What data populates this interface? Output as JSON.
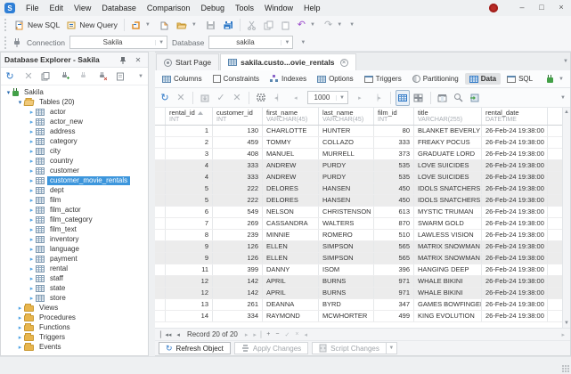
{
  "titlebar": {
    "menus": [
      "File",
      "Edit",
      "View",
      "Database",
      "Comparison",
      "Debug",
      "Tools",
      "Window",
      "Help"
    ]
  },
  "toolbar": {
    "new_sql_label": "New SQL",
    "new_query_label": "New Query"
  },
  "connection_bar": {
    "connection_label": "Connection",
    "connection_value": "Sakila",
    "database_label": "Database",
    "database_value": "sakila"
  },
  "sidebar": {
    "title": "Database Explorer - Sakila",
    "tree": [
      {
        "label": "Sakila",
        "depth": 0,
        "icon": "plug",
        "expand": "expanded"
      },
      {
        "label": "Tables (20)",
        "depth": 1,
        "icon": "folder-open",
        "expand": "expanded"
      },
      {
        "label": "actor",
        "depth": 2,
        "icon": "table",
        "expand": "collapsed"
      },
      {
        "label": "actor_new",
        "depth": 2,
        "icon": "table",
        "expand": "collapsed"
      },
      {
        "label": "address",
        "depth": 2,
        "icon": "table",
        "expand": "collapsed"
      },
      {
        "label": "category",
        "depth": 2,
        "icon": "table",
        "expand": "collapsed"
      },
      {
        "label": "city",
        "depth": 2,
        "icon": "table",
        "expand": "collapsed"
      },
      {
        "label": "country",
        "depth": 2,
        "icon": "table",
        "expand": "collapsed"
      },
      {
        "label": "customer",
        "depth": 2,
        "icon": "table",
        "expand": "collapsed"
      },
      {
        "label": "customer_movie_rentals",
        "depth": 2,
        "icon": "table",
        "expand": "collapsed",
        "selected": true
      },
      {
        "label": "dept",
        "depth": 2,
        "icon": "table",
        "expand": "collapsed"
      },
      {
        "label": "film",
        "depth": 2,
        "icon": "table",
        "expand": "collapsed"
      },
      {
        "label": "film_actor",
        "depth": 2,
        "icon": "table",
        "expand": "collapsed"
      },
      {
        "label": "film_category",
        "depth": 2,
        "icon": "table",
        "expand": "collapsed"
      },
      {
        "label": "film_text",
        "depth": 2,
        "icon": "table",
        "expand": "collapsed"
      },
      {
        "label": "inventory",
        "depth": 2,
        "icon": "table",
        "expand": "collapsed"
      },
      {
        "label": "language",
        "depth": 2,
        "icon": "table",
        "expand": "collapsed"
      },
      {
        "label": "payment",
        "depth": 2,
        "icon": "table",
        "expand": "collapsed"
      },
      {
        "label": "rental",
        "depth": 2,
        "icon": "table",
        "expand": "collapsed"
      },
      {
        "label": "staff",
        "depth": 2,
        "icon": "table",
        "expand": "collapsed"
      },
      {
        "label": "state",
        "depth": 2,
        "icon": "table",
        "expand": "collapsed"
      },
      {
        "label": "store",
        "depth": 2,
        "icon": "table",
        "expand": "collapsed"
      },
      {
        "label": "Views",
        "depth": 1,
        "icon": "folder",
        "expand": "collapsed"
      },
      {
        "label": "Procedures",
        "depth": 1,
        "icon": "folder",
        "expand": "collapsed"
      },
      {
        "label": "Functions",
        "depth": 1,
        "icon": "folder",
        "expand": "collapsed"
      },
      {
        "label": "Triggers",
        "depth": 1,
        "icon": "folder",
        "expand": "collapsed"
      },
      {
        "label": "Events",
        "depth": 1,
        "icon": "folder",
        "expand": "collapsed"
      }
    ]
  },
  "doc_tabs": {
    "start_page_label": "Start Page",
    "active_tab_label": "sakila.custo...ovie_rentals"
  },
  "subtabs": [
    {
      "label": "Columns",
      "icon": "columns-icon",
      "style": "grid"
    },
    {
      "label": "Constraints",
      "icon": "constraints-icon",
      "style": "brackets"
    },
    {
      "label": "Indexes",
      "icon": "indexes-icon",
      "style": "tree3"
    },
    {
      "label": "Options",
      "icon": "options-icon",
      "style": "grid"
    },
    {
      "label": "Triggers",
      "icon": "triggers-icon",
      "style": "window"
    },
    {
      "label": "Partitioning",
      "icon": "partitioning-icon",
      "style": "pie"
    },
    {
      "label": "Data",
      "icon": "data-icon",
      "style": "grid-blue",
      "active": true
    },
    {
      "label": "SQL",
      "icon": "sql-icon",
      "style": "window"
    }
  ],
  "data_toolbar": {
    "page_size": "1000"
  },
  "grid": {
    "columns": [
      {
        "name": "rental_id",
        "type": "INT",
        "align": "right",
        "sorted": true
      },
      {
        "name": "customer_id",
        "type": "INT",
        "align": "right"
      },
      {
        "name": "first_name",
        "type": "VARCHAR(45)",
        "align": "left"
      },
      {
        "name": "last_name",
        "type": "VARCHAR(45)",
        "align": "left"
      },
      {
        "name": "film_id",
        "type": "INT",
        "align": "right"
      },
      {
        "name": "title",
        "type": "VARCHAR(255)",
        "align": "left"
      },
      {
        "name": "rental_date",
        "type": "DATETIME",
        "align": "left"
      }
    ],
    "rows": [
      {
        "cells": [
          "1",
          "130",
          "CHARLOTTE",
          "HUNTER",
          "80",
          "BLANKET BEVERLY",
          "26-Feb-24 19:38:00"
        ],
        "highlighted": false
      },
      {
        "cells": [
          "2",
          "459",
          "TOMMY",
          "COLLAZO",
          "333",
          "FREAKY POCUS",
          "26-Feb-24 19:38:00"
        ],
        "highlighted": false
      },
      {
        "cells": [
          "3",
          "408",
          "MANUEL",
          "MURRELL",
          "373",
          "GRADUATE LORD",
          "26-Feb-24 19:38:00"
        ],
        "highlighted": false
      },
      {
        "cells": [
          "4",
          "333",
          "ANDREW",
          "PURDY",
          "535",
          "LOVE SUICIDES",
          "26-Feb-24 19:38:00"
        ],
        "highlighted": true
      },
      {
        "cells": [
          "4",
          "333",
          "ANDREW",
          "PURDY",
          "535",
          "LOVE SUICIDES",
          "26-Feb-24 19:38:00"
        ],
        "highlighted": true
      },
      {
        "cells": [
          "5",
          "222",
          "DELORES",
          "HANSEN",
          "450",
          "IDOLS SNATCHERS",
          "26-Feb-24 19:38:00"
        ],
        "highlighted": true
      },
      {
        "cells": [
          "5",
          "222",
          "DELORES",
          "HANSEN",
          "450",
          "IDOLS SNATCHERS",
          "26-Feb-24 19:38:00"
        ],
        "highlighted": true
      },
      {
        "cells": [
          "6",
          "549",
          "NELSON",
          "CHRISTENSON",
          "613",
          "MYSTIC TRUMAN",
          "26-Feb-24 19:38:00"
        ],
        "highlighted": false
      },
      {
        "cells": [
          "7",
          "269",
          "CASSANDRA",
          "WALTERS",
          "870",
          "SWARM GOLD",
          "26-Feb-24 19:38:00"
        ],
        "highlighted": false
      },
      {
        "cells": [
          "8",
          "239",
          "MINNIE",
          "ROMERO",
          "510",
          "LAWLESS VISION",
          "26-Feb-24 19:38:00"
        ],
        "highlighted": false
      },
      {
        "cells": [
          "9",
          "126",
          "ELLEN",
          "SIMPSON",
          "565",
          "MATRIX SNOWMAN",
          "26-Feb-24 19:38:00"
        ],
        "highlighted": true
      },
      {
        "cells": [
          "9",
          "126",
          "ELLEN",
          "SIMPSON",
          "565",
          "MATRIX SNOWMAN",
          "26-Feb-24 19:38:00"
        ],
        "highlighted": true
      },
      {
        "cells": [
          "11",
          "399",
          "DANNY",
          "ISOM",
          "396",
          "HANGING DEEP",
          "26-Feb-24 19:38:00"
        ],
        "highlighted": false
      },
      {
        "cells": [
          "12",
          "142",
          "APRIL",
          "BURNS",
          "971",
          "WHALE BIKINI",
          "26-Feb-24 19:38:00"
        ],
        "highlighted": true
      },
      {
        "cells": [
          "12",
          "142",
          "APRIL",
          "BURNS",
          "971",
          "WHALE BIKINI",
          "26-Feb-24 19:38:00"
        ],
        "highlighted": true
      },
      {
        "cells": [
          "13",
          "261",
          "DEANNA",
          "BYRD",
          "347",
          "GAMES BOWFINGER",
          "26-Feb-24 19:38:00"
        ],
        "highlighted": false
      },
      {
        "cells": [
          "14",
          "334",
          "RAYMOND",
          "MCWHORTER",
          "499",
          "KING EVOLUTION",
          "26-Feb-24 19:38:00"
        ],
        "highlighted": false
      }
    ]
  },
  "record_navigator": {
    "text": "Record 20 of 20"
  },
  "actions": {
    "refresh_label": "Refresh Object",
    "apply_label": "Apply Changes",
    "script_label": "Script Changes"
  },
  "colors": {
    "accent_blue": "#2e78c7",
    "selection_blue": "#3d96dc",
    "connected_green": "#43a047",
    "folder_tan": "#e8b54d",
    "badge_red": "#b92b27",
    "duplicate_row_gray": "#ececec"
  }
}
